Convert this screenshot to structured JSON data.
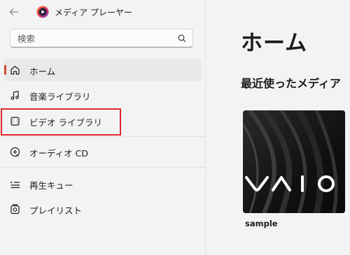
{
  "app": {
    "title": "メディア プレーヤー"
  },
  "search": {
    "placeholder": "検索"
  },
  "nav": {
    "items": [
      {
        "label": "ホーム",
        "icon": "home-icon"
      },
      {
        "label": "音楽ライブラリ",
        "icon": "music-note-icon"
      },
      {
        "label": "ビデオ ライブラリ",
        "icon": "film-icon"
      },
      {
        "label": "オーディオ CD",
        "icon": "disc-icon"
      },
      {
        "label": "再生キュー",
        "icon": "queue-icon"
      },
      {
        "label": "プレイリスト",
        "icon": "playlist-icon"
      }
    ],
    "selected": "ホーム"
  },
  "main": {
    "title": "ホーム",
    "recent_title": "最近使ったメディア",
    "recent_items": [
      {
        "label": "sample",
        "thumbnail_logo": "VAIO"
      }
    ]
  },
  "colors": {
    "accent": "#d0462b",
    "highlight_box": "#e0262e",
    "background": "#f3f3f3"
  }
}
